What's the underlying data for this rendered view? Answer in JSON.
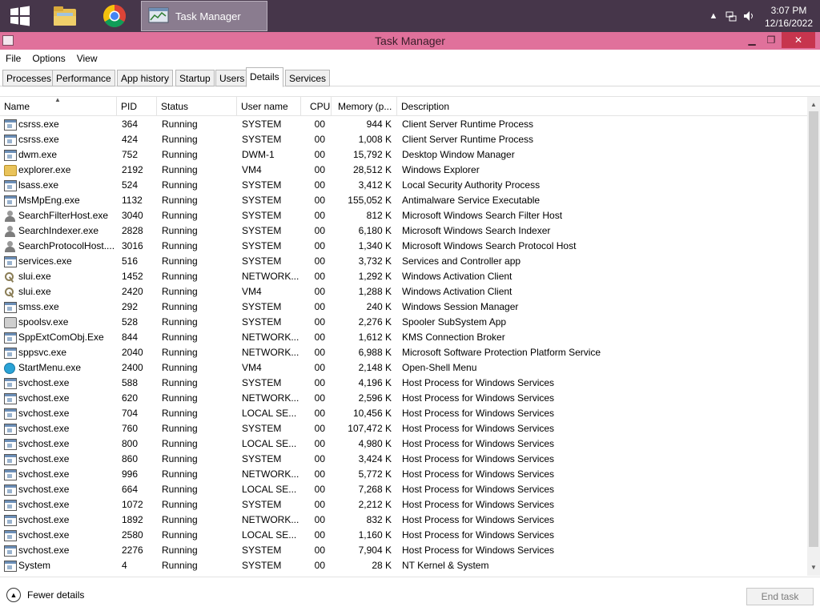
{
  "taskbar": {
    "task_label": "Task Manager",
    "clock_time": "3:07 PM",
    "clock_date": "12/16/2022"
  },
  "window": {
    "title": "Task Manager"
  },
  "menu": [
    "File",
    "Options",
    "View"
  ],
  "tabs": [
    "Processes",
    "Performance",
    "App history",
    "Startup",
    "Users",
    "Details",
    "Services"
  ],
  "active_tab": "Details",
  "columns": {
    "name": "Name",
    "pid": "PID",
    "status": "Status",
    "user": "User name",
    "cpu": "CPU",
    "memory": "Memory (p...",
    "description": "Description"
  },
  "rows": [
    {
      "name": "csrss.exe",
      "pid": "364",
      "status": "Running",
      "user": "SYSTEM",
      "cpu": "00",
      "memory": "944 K",
      "desc": "Client Server Runtime Process",
      "icon": "exe"
    },
    {
      "name": "csrss.exe",
      "pid": "424",
      "status": "Running",
      "user": "SYSTEM",
      "cpu": "00",
      "memory": "1,008 K",
      "desc": "Client Server Runtime Process",
      "icon": "exe"
    },
    {
      "name": "dwm.exe",
      "pid": "752",
      "status": "Running",
      "user": "DWM-1",
      "cpu": "00",
      "memory": "15,792 K",
      "desc": "Desktop Window Manager",
      "icon": "exe"
    },
    {
      "name": "explorer.exe",
      "pid": "2192",
      "status": "Running",
      "user": "VM4",
      "cpu": "00",
      "memory": "28,512 K",
      "desc": "Windows Explorer",
      "icon": "folder"
    },
    {
      "name": "lsass.exe",
      "pid": "524",
      "status": "Running",
      "user": "SYSTEM",
      "cpu": "00",
      "memory": "3,412 K",
      "desc": "Local Security Authority Process",
      "icon": "exe"
    },
    {
      "name": "MsMpEng.exe",
      "pid": "1132",
      "status": "Running",
      "user": "SYSTEM",
      "cpu": "00",
      "memory": "155,052 K",
      "desc": "Antimalware Service Executable",
      "icon": "exe"
    },
    {
      "name": "SearchFilterHost.exe",
      "pid": "3040",
      "status": "Running",
      "user": "SYSTEM",
      "cpu": "00",
      "memory": "812 K",
      "desc": "Microsoft Windows Search Filter Host",
      "icon": "person"
    },
    {
      "name": "SearchIndexer.exe",
      "pid": "2828",
      "status": "Running",
      "user": "SYSTEM",
      "cpu": "00",
      "memory": "6,180 K",
      "desc": "Microsoft Windows Search Indexer",
      "icon": "person"
    },
    {
      "name": "SearchProtocolHost....",
      "pid": "3016",
      "status": "Running",
      "user": "SYSTEM",
      "cpu": "00",
      "memory": "1,340 K",
      "desc": "Microsoft Windows Search Protocol Host",
      "icon": "person"
    },
    {
      "name": "services.exe",
      "pid": "516",
      "status": "Running",
      "user": "SYSTEM",
      "cpu": "00",
      "memory": "3,732 K",
      "desc": "Services and Controller app",
      "icon": "exe"
    },
    {
      "name": "slui.exe",
      "pid": "1452",
      "status": "Running",
      "user": "NETWORK...",
      "cpu": "00",
      "memory": "1,292 K",
      "desc": "Windows Activation Client",
      "icon": "key"
    },
    {
      "name": "slui.exe",
      "pid": "2420",
      "status": "Running",
      "user": "VM4",
      "cpu": "00",
      "memory": "1,288 K",
      "desc": "Windows Activation Client",
      "icon": "key"
    },
    {
      "name": "smss.exe",
      "pid": "292",
      "status": "Running",
      "user": "SYSTEM",
      "cpu": "00",
      "memory": "240 K",
      "desc": "Windows Session Manager",
      "icon": "exe"
    },
    {
      "name": "spoolsv.exe",
      "pid": "528",
      "status": "Running",
      "user": "SYSTEM",
      "cpu": "00",
      "memory": "2,276 K",
      "desc": "Spooler SubSystem App",
      "icon": "printer"
    },
    {
      "name": "SppExtComObj.Exe",
      "pid": "844",
      "status": "Running",
      "user": "NETWORK...",
      "cpu": "00",
      "memory": "1,612 K",
      "desc": "KMS Connection Broker",
      "icon": "exe"
    },
    {
      "name": "sppsvc.exe",
      "pid": "2040",
      "status": "Running",
      "user": "NETWORK...",
      "cpu": "00",
      "memory": "6,988 K",
      "desc": "Microsoft Software Protection Platform Service",
      "icon": "exe"
    },
    {
      "name": "StartMenu.exe",
      "pid": "2400",
      "status": "Running",
      "user": "VM4",
      "cpu": "00",
      "memory": "2,148 K",
      "desc": "Open-Shell Menu",
      "icon": "globe"
    },
    {
      "name": "svchost.exe",
      "pid": "588",
      "status": "Running",
      "user": "SYSTEM",
      "cpu": "00",
      "memory": "4,196 K",
      "desc": "Host Process for Windows Services",
      "icon": "exe"
    },
    {
      "name": "svchost.exe",
      "pid": "620",
      "status": "Running",
      "user": "NETWORK...",
      "cpu": "00",
      "memory": "2,596 K",
      "desc": "Host Process for Windows Services",
      "icon": "exe"
    },
    {
      "name": "svchost.exe",
      "pid": "704",
      "status": "Running",
      "user": "LOCAL SE...",
      "cpu": "00",
      "memory": "10,456 K",
      "desc": "Host Process for Windows Services",
      "icon": "exe"
    },
    {
      "name": "svchost.exe",
      "pid": "760",
      "status": "Running",
      "user": "SYSTEM",
      "cpu": "00",
      "memory": "107,472 K",
      "desc": "Host Process for Windows Services",
      "icon": "exe"
    },
    {
      "name": "svchost.exe",
      "pid": "800",
      "status": "Running",
      "user": "LOCAL SE...",
      "cpu": "00",
      "memory": "4,980 K",
      "desc": "Host Process for Windows Services",
      "icon": "exe"
    },
    {
      "name": "svchost.exe",
      "pid": "860",
      "status": "Running",
      "user": "SYSTEM",
      "cpu": "00",
      "memory": "3,424 K",
      "desc": "Host Process for Windows Services",
      "icon": "exe"
    },
    {
      "name": "svchost.exe",
      "pid": "996",
      "status": "Running",
      "user": "NETWORK...",
      "cpu": "00",
      "memory": "5,772 K",
      "desc": "Host Process for Windows Services",
      "icon": "exe"
    },
    {
      "name": "svchost.exe",
      "pid": "664",
      "status": "Running",
      "user": "LOCAL SE...",
      "cpu": "00",
      "memory": "7,268 K",
      "desc": "Host Process for Windows Services",
      "icon": "exe"
    },
    {
      "name": "svchost.exe",
      "pid": "1072",
      "status": "Running",
      "user": "SYSTEM",
      "cpu": "00",
      "memory": "2,212 K",
      "desc": "Host Process for Windows Services",
      "icon": "exe"
    },
    {
      "name": "svchost.exe",
      "pid": "1892",
      "status": "Running",
      "user": "NETWORK...",
      "cpu": "00",
      "memory": "832 K",
      "desc": "Host Process for Windows Services",
      "icon": "exe"
    },
    {
      "name": "svchost.exe",
      "pid": "2580",
      "status": "Running",
      "user": "LOCAL SE...",
      "cpu": "00",
      "memory": "1,160 K",
      "desc": "Host Process for Windows Services",
      "icon": "exe"
    },
    {
      "name": "svchost.exe",
      "pid": "2276",
      "status": "Running",
      "user": "SYSTEM",
      "cpu": "00",
      "memory": "7,904 K",
      "desc": "Host Process for Windows Services",
      "icon": "exe"
    },
    {
      "name": "System",
      "pid": "4",
      "status": "Running",
      "user": "SYSTEM",
      "cpu": "00",
      "memory": "28 K",
      "desc": "NT Kernel & System",
      "icon": "exe"
    }
  ],
  "footer": {
    "fewer_details": "Fewer details",
    "end_task": "End task"
  },
  "colors": {
    "taskbar": "#46364a",
    "titlebar": "#e0719b",
    "close_button": "#c7354e"
  }
}
